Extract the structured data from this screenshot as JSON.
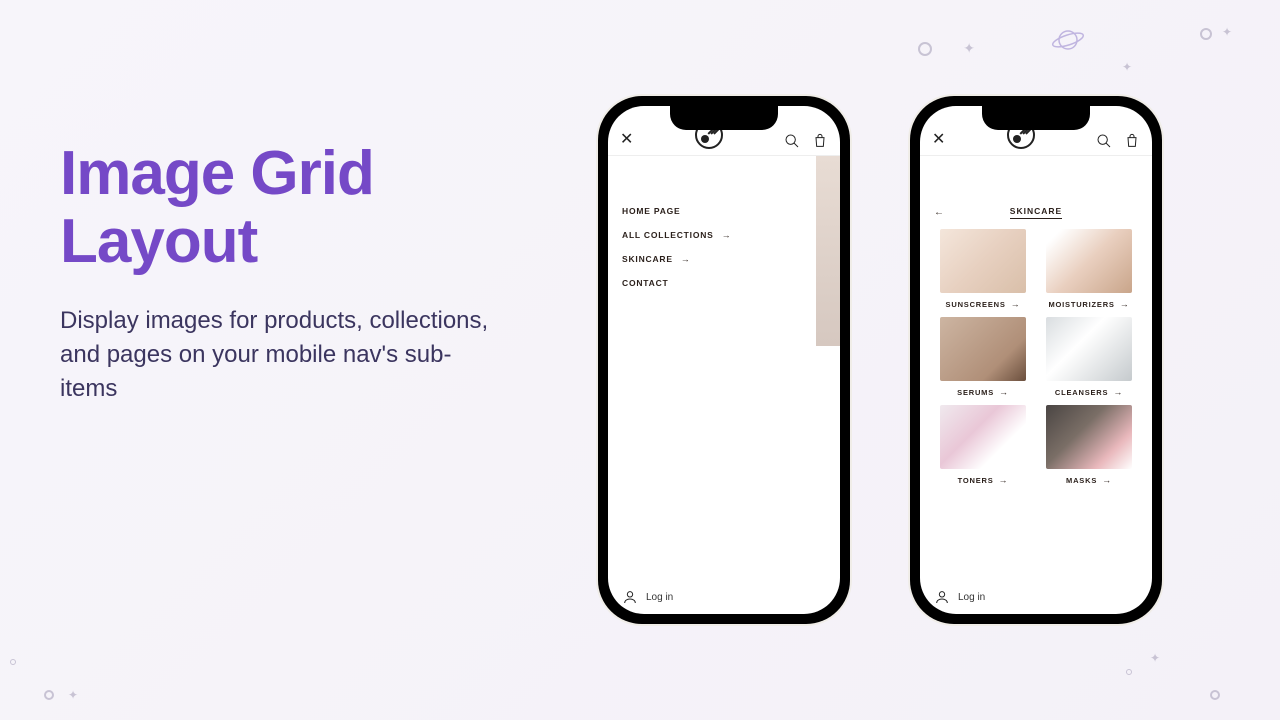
{
  "hero": {
    "title": "Image Grid Layout",
    "subtitle": "Display images for products, collections, and pages on your mobile nav's sub-items"
  },
  "phone_a": {
    "menu": {
      "items": [
        {
          "label": "HOME PAGE",
          "has_children": false
        },
        {
          "label": "ALL COLLECTIONS",
          "has_children": true
        },
        {
          "label": "SKINCARE",
          "has_children": true
        },
        {
          "label": "CONTACT",
          "has_children": false
        }
      ]
    },
    "footer_login": "Log in"
  },
  "phone_b": {
    "back_label": "←",
    "submenu_title": "SKINCARE",
    "tiles": [
      {
        "label": "SUNSCREENS"
      },
      {
        "label": "MOISTURIZERS"
      },
      {
        "label": "SERUMS"
      },
      {
        "label": "CLEANSERS"
      },
      {
        "label": "TONERS"
      },
      {
        "label": "MASKS"
      }
    ],
    "footer_login": "Log in"
  }
}
